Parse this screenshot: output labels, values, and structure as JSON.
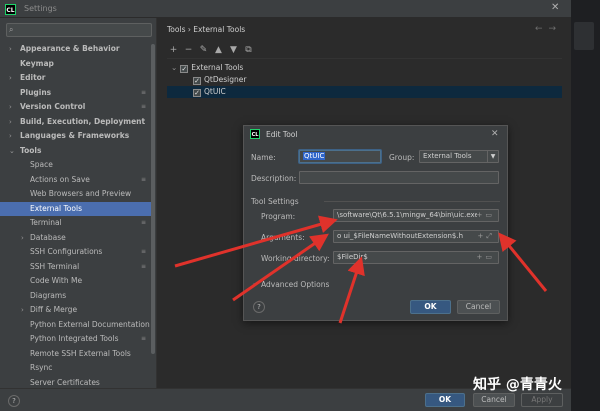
{
  "window": {
    "title": "Settings",
    "app_icon_text": "CL"
  },
  "sidebar": {
    "search_placeholder": "",
    "items": [
      {
        "label": "Appearance & Behavior",
        "bold": true,
        "arrow": "›",
        "child": false,
        "selected": false,
        "mark": ""
      },
      {
        "label": "Keymap",
        "bold": true,
        "arrow": "",
        "child": false,
        "selected": false,
        "mark": ""
      },
      {
        "label": "Editor",
        "bold": true,
        "arrow": "›",
        "child": false,
        "selected": false,
        "mark": ""
      },
      {
        "label": "Plugins",
        "bold": true,
        "arrow": "",
        "child": false,
        "selected": false,
        "mark": "≡"
      },
      {
        "label": "Version Control",
        "bold": true,
        "arrow": "›",
        "child": false,
        "selected": false,
        "mark": "≡"
      },
      {
        "label": "Build, Execution, Deployment",
        "bold": true,
        "arrow": "›",
        "child": false,
        "selected": false,
        "mark": ""
      },
      {
        "label": "Languages & Frameworks",
        "bold": true,
        "arrow": "›",
        "child": false,
        "selected": false,
        "mark": ""
      },
      {
        "label": "Tools",
        "bold": true,
        "arrow": "⌄",
        "child": false,
        "selected": false,
        "mark": ""
      },
      {
        "label": "Space",
        "bold": false,
        "arrow": "",
        "child": true,
        "selected": false,
        "mark": ""
      },
      {
        "label": "Actions on Save",
        "bold": false,
        "arrow": "",
        "child": true,
        "selected": false,
        "mark": "≡"
      },
      {
        "label": "Web Browsers and Preview",
        "bold": false,
        "arrow": "",
        "child": true,
        "selected": false,
        "mark": ""
      },
      {
        "label": "External Tools",
        "bold": false,
        "arrow": "",
        "child": true,
        "selected": true,
        "mark": ""
      },
      {
        "label": "Terminal",
        "bold": false,
        "arrow": "",
        "child": true,
        "selected": false,
        "mark": "≡"
      },
      {
        "label": "Database",
        "bold": false,
        "arrow": "›",
        "child": true,
        "selected": false,
        "mark": ""
      },
      {
        "label": "SSH Configurations",
        "bold": false,
        "arrow": "",
        "child": true,
        "selected": false,
        "mark": "≡"
      },
      {
        "label": "SSH Terminal",
        "bold": false,
        "arrow": "",
        "child": true,
        "selected": false,
        "mark": "≡"
      },
      {
        "label": "Code With Me",
        "bold": false,
        "arrow": "",
        "child": true,
        "selected": false,
        "mark": ""
      },
      {
        "label": "Diagrams",
        "bold": false,
        "arrow": "",
        "child": true,
        "selected": false,
        "mark": ""
      },
      {
        "label": "Diff & Merge",
        "bold": false,
        "arrow": "›",
        "child": true,
        "selected": false,
        "mark": ""
      },
      {
        "label": "Python External Documentation",
        "bold": false,
        "arrow": "",
        "child": true,
        "selected": false,
        "mark": ""
      },
      {
        "label": "Python Integrated Tools",
        "bold": false,
        "arrow": "",
        "child": true,
        "selected": false,
        "mark": "≡"
      },
      {
        "label": "Remote SSH External Tools",
        "bold": false,
        "arrow": "",
        "child": true,
        "selected": false,
        "mark": ""
      },
      {
        "label": "Rsync",
        "bold": false,
        "arrow": "",
        "child": true,
        "selected": false,
        "mark": ""
      },
      {
        "label": "Server Certificates",
        "bold": false,
        "arrow": "",
        "child": true,
        "selected": false,
        "mark": ""
      }
    ]
  },
  "main": {
    "breadcrumb": "Tools  ›  External Tools",
    "nav_back": "←",
    "nav_forward": "→",
    "toolbar": [
      "+",
      "−",
      "✎",
      "▲",
      "▼",
      "⧉"
    ],
    "tool_groups": [
      {
        "label": "External Tools",
        "checked": true,
        "expanded": true,
        "tools": [
          {
            "label": "QtDesigner",
            "checked": true,
            "selected": false
          },
          {
            "label": "QtUIC",
            "checked": true,
            "selected": true
          }
        ]
      }
    ]
  },
  "bottom": {
    "help": "?",
    "ok": "OK",
    "cancel": "Cancel",
    "apply": "Apply"
  },
  "watermark": "知乎 @青青火",
  "dialog": {
    "title": "Edit Tool",
    "close": "✕",
    "name_label": "Name:",
    "name_value": "QtUIC",
    "group_label": "Group:",
    "group_value": "External Tools",
    "description_label": "Description:",
    "description_value": "",
    "section_label": "Tool Settings",
    "program_label": "Program:",
    "program_value": "\\software\\Qt\\6.5.1\\mingw_64\\bin\\uic.exe",
    "arguments_label": "Arguments:",
    "arguments_value": "o ui_$FileNameWithoutExtension$.h",
    "workdir_label": "Working directory:",
    "workdir_value": "$FileDir$",
    "advanced_label": "Advanced Options",
    "help": "?",
    "ok": "OK",
    "cancel": "Cancel"
  },
  "colors": {
    "accent": "#4b6eaf",
    "arrow_annotation": "#e0322b",
    "primary_button": "#365880"
  }
}
